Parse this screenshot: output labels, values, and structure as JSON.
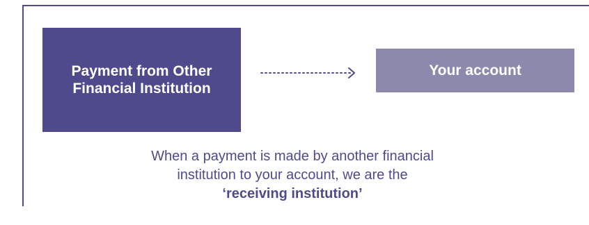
{
  "diagram": {
    "source_box": {
      "label": "Payment from Other Financial Institution"
    },
    "target_box": {
      "label": "Your account"
    },
    "caption": {
      "line1": "When a payment is made by another financial",
      "line2": "institution to your account, we are the",
      "emphasis": "‘receiving institution’"
    },
    "colors": {
      "primary": "#4f4a8c",
      "secondary": "#8c89ad",
      "text_on_box": "#ffffff"
    }
  }
}
